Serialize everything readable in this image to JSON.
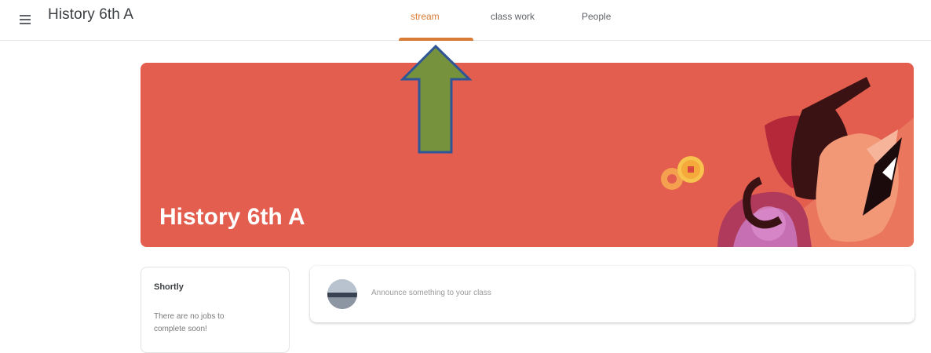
{
  "header": {
    "class_title": "History 6th A",
    "tabs": [
      {
        "label": "stream",
        "active": true
      },
      {
        "label": "class work",
        "active": false
      },
      {
        "label": "People",
        "active": false
      }
    ],
    "accent_color": "#d97b34"
  },
  "banner": {
    "title": "History 6th A",
    "color": "#e35e4f"
  },
  "upcoming": {
    "title": "Shortly",
    "message": "There are no jobs to complete soon!"
  },
  "announce": {
    "placeholder": "Announce something to your class"
  },
  "overlay": {
    "arrow_color": "#76923c",
    "arrow_outline": "#2f5597"
  }
}
